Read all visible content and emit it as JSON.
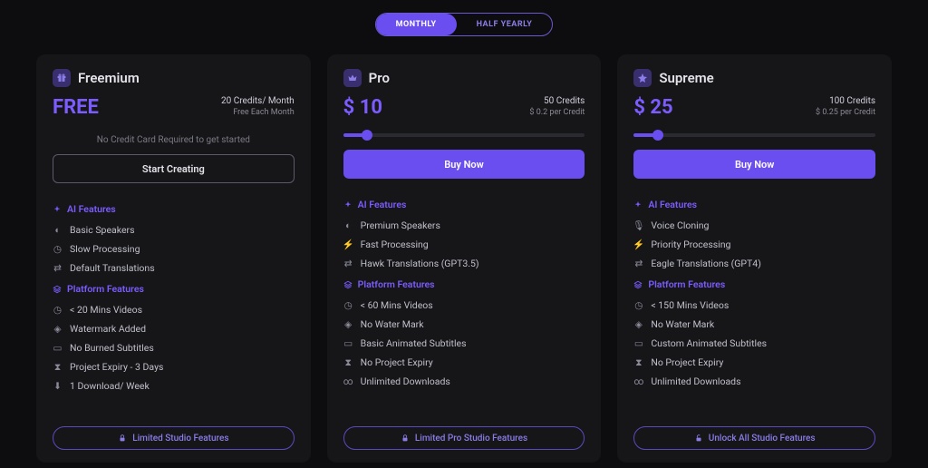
{
  "toggle": {
    "monthly": "MONTHLY",
    "half_yearly": "HALF YEARLY"
  },
  "plans": [
    {
      "name": "Freemium",
      "price": "FREE",
      "credits_line": "20 Credits/ Month",
      "credits_sub": "Free Each Month",
      "note": "No Credit Card Required to get started",
      "cta": "Start Creating",
      "cta_style": "outline",
      "has_slider": false,
      "ai_head": "AI Features",
      "ai": [
        "Basic Speakers",
        "Slow Processing",
        "Default Translations"
      ],
      "pf_head": "Platform Features",
      "pf": [
        "< 20 Mins Videos",
        "Watermark Added",
        "No Burned Subtitles",
        "Project Expiry - 3 Days",
        "1 Download/ Week"
      ],
      "footer": "Limited Studio Features"
    },
    {
      "name": "Pro",
      "price": "$ 10",
      "credits_line": "50 Credits",
      "credits_sub": "$ 0.2 per Credit",
      "cta": "Buy Now",
      "cta_style": "filled",
      "has_slider": true,
      "ai_head": "AI Features",
      "ai": [
        "Premium Speakers",
        "Fast Processing",
        "Hawk Translations (GPT3.5)"
      ],
      "pf_head": "Platform Features",
      "pf": [
        "< 60 Mins Videos",
        "No Water Mark",
        "Basic Animated Subtitles",
        "No Project Expiry",
        "Unlimited Downloads"
      ],
      "footer": "Limited Pro Studio Features"
    },
    {
      "name": "Supreme",
      "price": "$ 25",
      "credits_line": "100 Credits",
      "credits_sub": "$ 0.25 per Credit",
      "cta": "Buy Now",
      "cta_style": "filled",
      "has_slider": true,
      "ai_head": "AI Features",
      "ai": [
        "Voice Cloning",
        "Priority Processing",
        "Eagle Translations (GPT4)"
      ],
      "pf_head": "Platform Features",
      "pf": [
        "< 150 Mins Videos",
        "No Water Mark",
        "Custom Animated Subtitles",
        "No Project Expiry",
        "Unlimited Downloads"
      ],
      "footer": "Unlock All Studio Features"
    }
  ]
}
